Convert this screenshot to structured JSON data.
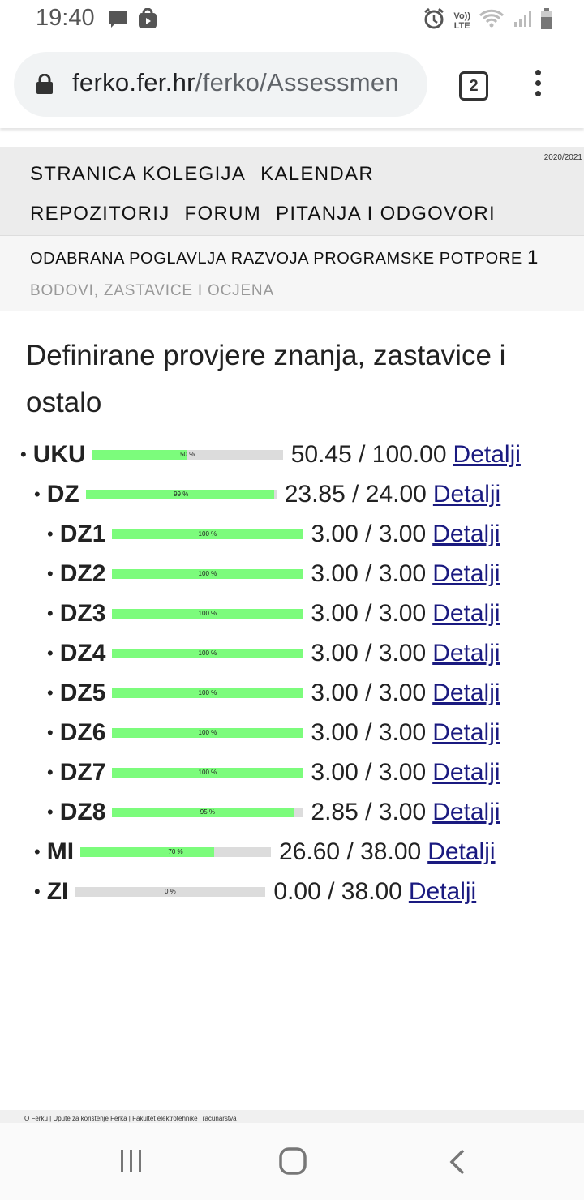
{
  "status_bar": {
    "time": "19:40",
    "icons": [
      "message-icon",
      "lock-badge-icon",
      "alarm-icon",
      "volte-icon",
      "wifi-icon",
      "signal-icon",
      "battery-icon"
    ],
    "volte_top": "Vo))",
    "volte_bottom": "LTE"
  },
  "browser": {
    "url_host": "ferko.fer.hr",
    "url_path": "/ferko/Assessmen",
    "tab_count": "2"
  },
  "site": {
    "year": "2020/2021",
    "nav_row1": [
      "STRANICA KOLEGIJA",
      "KALENDAR"
    ],
    "nav_row2": [
      "REPOZITORIJ",
      "FORUM",
      "PITANJA I ODGOVORI"
    ],
    "course_title": "ODABRANA POGLAVLJA RAZVOJA PROGRAMSKE POTPORE",
    "course_number": "1",
    "course_subtitle": "BODOVI, ZASTAVICE I OCJENA"
  },
  "main": {
    "heading": "Definirane provjere znanja, zastavice i ostalo",
    "detail_label": "Detalji",
    "assessments": [
      {
        "label": "UKU",
        "percent": 50,
        "percent_text": "50 %",
        "score": "50.45 / 100.00",
        "level": 0
      },
      {
        "label": "DZ",
        "percent": 99,
        "percent_text": "99 %",
        "score": "23.85 / 24.00",
        "level": 1
      },
      {
        "label": "DZ1",
        "percent": 100,
        "percent_text": "100 %",
        "score": "3.00 / 3.00",
        "level": 2
      },
      {
        "label": "DZ2",
        "percent": 100,
        "percent_text": "100 %",
        "score": "3.00 / 3.00",
        "level": 2
      },
      {
        "label": "DZ3",
        "percent": 100,
        "percent_text": "100 %",
        "score": "3.00 / 3.00",
        "level": 2
      },
      {
        "label": "DZ4",
        "percent": 100,
        "percent_text": "100 %",
        "score": "3.00 / 3.00",
        "level": 2
      },
      {
        "label": "DZ5",
        "percent": 100,
        "percent_text": "100 %",
        "score": "3.00 / 3.00",
        "level": 2
      },
      {
        "label": "DZ6",
        "percent": 100,
        "percent_text": "100 %",
        "score": "3.00 / 3.00",
        "level": 2
      },
      {
        "label": "DZ7",
        "percent": 100,
        "percent_text": "100 %",
        "score": "3.00 / 3.00",
        "level": 2
      },
      {
        "label": "DZ8",
        "percent": 95,
        "percent_text": "95 %",
        "score": "2.85 / 3.00",
        "level": 2
      },
      {
        "label": "MI",
        "percent": 70,
        "percent_text": "70 %",
        "score": "26.60 / 38.00",
        "level": 1
      },
      {
        "label": "ZI",
        "percent": 0,
        "percent_text": "0 %",
        "score": "0.00 / 38.00",
        "level": 1
      }
    ]
  },
  "footer": {
    "text": "O Ferku | Upute za korištenje Ferka | Fakultet elektrotehnike i računarstva"
  },
  "colors": {
    "bar_fill": "#7cfc7c",
    "bar_track": "#dcdcdc",
    "link": "#1a1a80",
    "nav_background": "#ececec"
  }
}
